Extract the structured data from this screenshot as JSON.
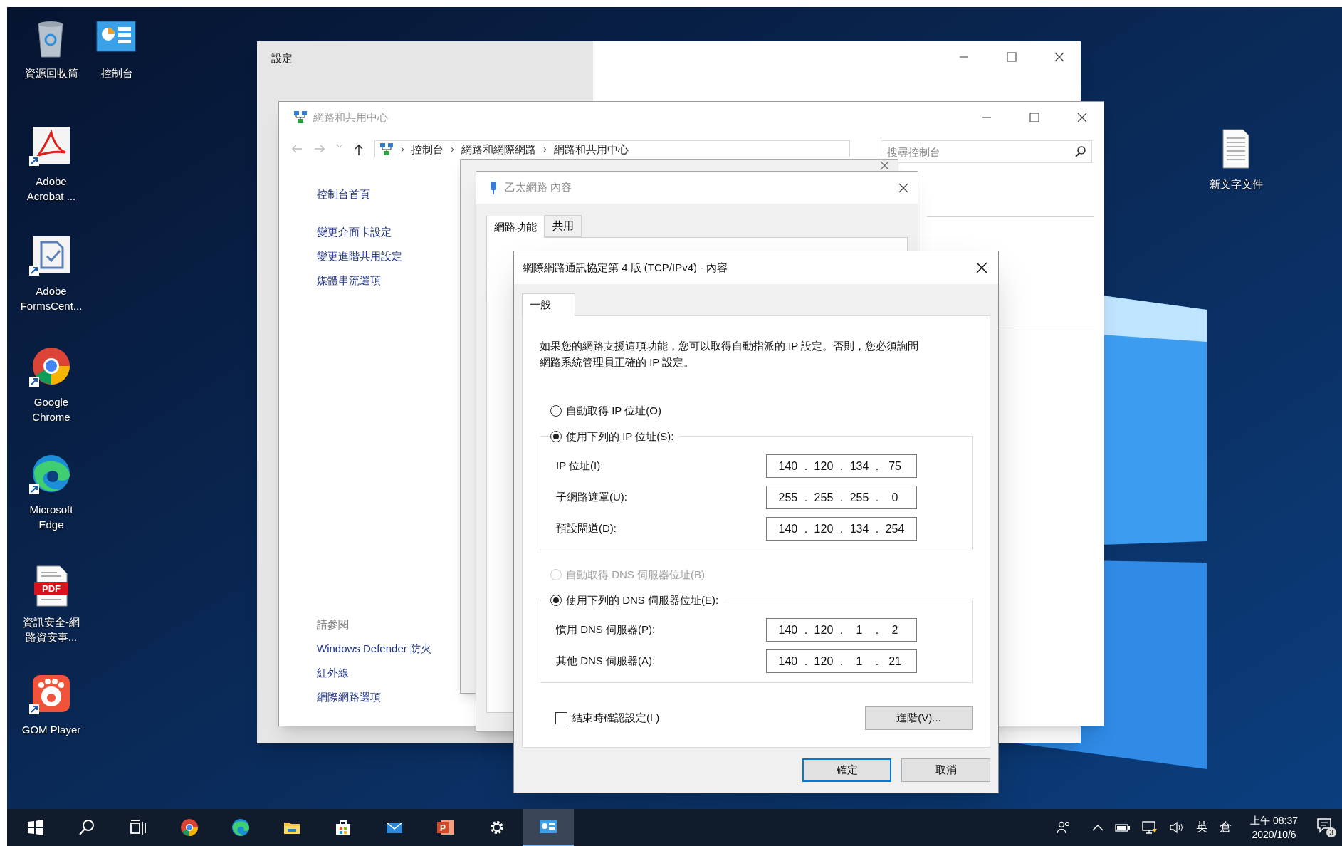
{
  "desktop_icons": [
    {
      "kind": "recycle-bin",
      "label": "資源回收筒",
      "shortcut": false
    },
    {
      "kind": "control-panel",
      "label": "控制台",
      "shortcut": false
    },
    {
      "kind": "acrobat",
      "label": "Adobe Acrobat ...",
      "shortcut": true
    },
    {
      "kind": "forms",
      "label": "Adobe FormsCent...",
      "shortcut": true
    },
    {
      "kind": "chrome",
      "label": "Google Chrome",
      "shortcut": true
    },
    {
      "kind": "edge",
      "label": "Microsoft Edge",
      "shortcut": true
    },
    {
      "kind": "pdf",
      "label": "資訊安全-網路資安事...",
      "badge": "PDF",
      "shortcut": false
    },
    {
      "kind": "gom",
      "label": "GOM Player",
      "shortcut": true
    },
    {
      "kind": "text-file",
      "label": "新文字文件",
      "shortcut": false
    }
  ],
  "settings_window": {
    "title": "設定"
  },
  "network_center": {
    "title": "網路和共用中心",
    "breadcrumb_separator": "›",
    "breadcrumb": [
      "控制台",
      "網路和網際網路",
      "網路和共用中心"
    ],
    "search": {
      "placeholder": "搜尋控制台"
    },
    "sidebar": [
      "控制台首頁",
      "變更介面卡設定",
      "變更進階共用設定",
      "媒體串流選項"
    ],
    "see_also": {
      "heading": "請參閱",
      "links": [
        "Windows Defender 防火",
        "紅外線",
        "網際網路選項"
      ]
    }
  },
  "ethernet_properties": {
    "title": "乙太網路 內容",
    "tabs": [
      {
        "label": "網路功能",
        "selected": true
      },
      {
        "label": "共用",
        "selected": false
      }
    ]
  },
  "ipv4_dialog": {
    "title": "網際網路通訊協定第 4 版 (TCP/IPv4) - 內容",
    "tabs": [
      {
        "label": "一般",
        "selected": true
      }
    ],
    "description": "如果您的網路支援這項功能，您可以取得自動指派的 IP 設定。否則，您必須詢問網路系統管理員正確的 IP 設定。",
    "octet_separator": ".",
    "ip_options": [
      {
        "label": "自動取得 IP 位址(O)",
        "selected": false,
        "disabled": false
      },
      {
        "label": "使用下列的 IP 位址(S):",
        "selected": true,
        "disabled": false
      }
    ],
    "ip_fields": [
      {
        "label": "IP 位址(I):",
        "octets": [
          "140",
          "120",
          "134",
          "75"
        ]
      },
      {
        "label": "子網路遮罩(U):",
        "octets": [
          "255",
          "255",
          "255",
          "0"
        ]
      },
      {
        "label": "預設閘道(D):",
        "octets": [
          "140",
          "120",
          "134",
          "254"
        ]
      }
    ],
    "dns_options": [
      {
        "label": "自動取得 DNS 伺服器位址(B)",
        "selected": false,
        "disabled": true
      },
      {
        "label": "使用下列的 DNS 伺服器位址(E):",
        "selected": true,
        "disabled": false
      }
    ],
    "dns_fields": [
      {
        "label": "慣用 DNS 伺服器(P):",
        "octets": [
          "140",
          "120",
          "1",
          "2"
        ]
      },
      {
        "label": "其他 DNS 伺服器(A):",
        "octets": [
          "140",
          "120",
          "1",
          "21"
        ]
      }
    ],
    "validate_on_exit": {
      "label": "結束時確認設定(L)",
      "checked": false
    },
    "advanced_button": "進階(V)...",
    "buttons": [
      {
        "label": "確定",
        "default": true
      },
      {
        "label": "取消",
        "default": false
      }
    ]
  },
  "taskbar": {
    "items": [
      {
        "kind": "start",
        "active": false
      },
      {
        "kind": "search",
        "active": false
      },
      {
        "kind": "task-view",
        "active": false
      },
      {
        "kind": "chrome",
        "active": false
      },
      {
        "kind": "edge",
        "active": false
      },
      {
        "kind": "explorer",
        "active": false
      },
      {
        "kind": "store",
        "active": false
      },
      {
        "kind": "mail",
        "active": false
      },
      {
        "kind": "powerpoint",
        "glyph": "P",
        "active": false
      },
      {
        "kind": "settings",
        "active": false
      },
      {
        "kind": "control-panel",
        "active": true
      }
    ],
    "language": "英",
    "ime": "倉",
    "time": "上午 08:37",
    "date": "2020/10/6",
    "notifications": "3"
  }
}
